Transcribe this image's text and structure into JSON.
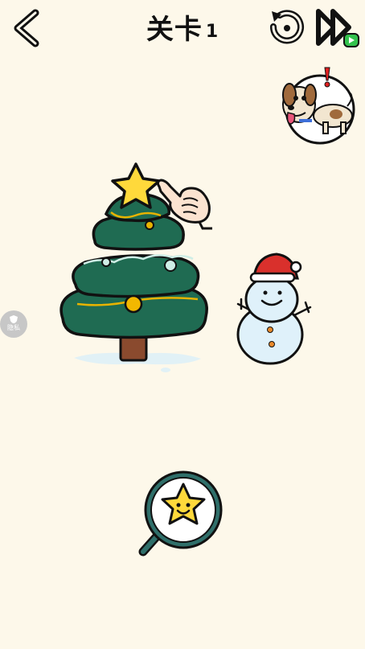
{
  "header": {
    "level_label": "关卡",
    "level_number": "1",
    "back_icon": "chevron-left-icon",
    "restart_icon": "restart-icon",
    "skip_icon": "skip-forward-video-icon"
  },
  "hint": {
    "icon": "dog-hint-icon",
    "alert": "!"
  },
  "privacy": {
    "label": "隐私",
    "icon": "shield-icon"
  },
  "scene": {
    "objects": [
      "christmas-tree",
      "tree-top-star",
      "pointing-hand",
      "snowman"
    ]
  },
  "target": {
    "icon": "smiling-star-icon"
  },
  "colors": {
    "background": "#fdf8ea",
    "tree_green": "#1f6b52",
    "star_yellow": "#ffd93b",
    "hat_red": "#d9302c",
    "snowman_blue": "#dff1fa",
    "garland_gold": "#e8b300",
    "garland_mint": "#cfeee6"
  }
}
